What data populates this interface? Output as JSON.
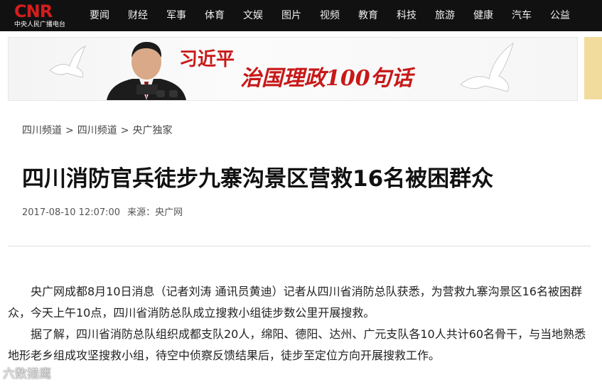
{
  "header": {
    "logo_text": "CNR",
    "logo_subtext": "中央人民广播电台",
    "nav": [
      {
        "label": "要闻"
      },
      {
        "label": "财经"
      },
      {
        "label": "军事"
      },
      {
        "label": "体育"
      },
      {
        "label": "文娱"
      },
      {
        "label": "图片"
      },
      {
        "label": "视频"
      },
      {
        "label": "教育"
      },
      {
        "label": "科技"
      },
      {
        "label": "旅游"
      },
      {
        "label": "健康"
      },
      {
        "label": "汽车"
      },
      {
        "label": "公益"
      }
    ]
  },
  "banner": {
    "name": "习近平",
    "slogan": "治国理政100句话"
  },
  "breadcrumb": [
    "四川频道",
    "四川频道",
    "央广独家"
  ],
  "breadcrumb_separator": ">",
  "article": {
    "title": "四川消防官兵徒步九寨沟景区营救16名被困群众",
    "datetime": "2017-08-10 12:07:00",
    "source": "来源：央广网",
    "paragraphs": [
      "央广网成都8月10日消息（记者刘涛 通讯员黄迪）记者从四川省消防总队获悉，为营救九寨沟景区16名被困群众，今天上午10点，四川省消防总队成立搜救小组徒步数公里开展搜救。",
      "据了解，四川省消防总队组织成都支队20人，绵阳、德阳、达州、广元支队各10人共计60名骨干，与当地熟悉地形老乡组成攻坚搜救小组，待空中侦察反馈结果后，徒步至定位方向开展搜救工作。"
    ]
  },
  "watermark": "六数猎鹰",
  "colors": {
    "nav_bg": "#111111",
    "brand_red": "#d51d1d",
    "banner_red": "#c81818",
    "side_strip": "#f2dc9d"
  }
}
